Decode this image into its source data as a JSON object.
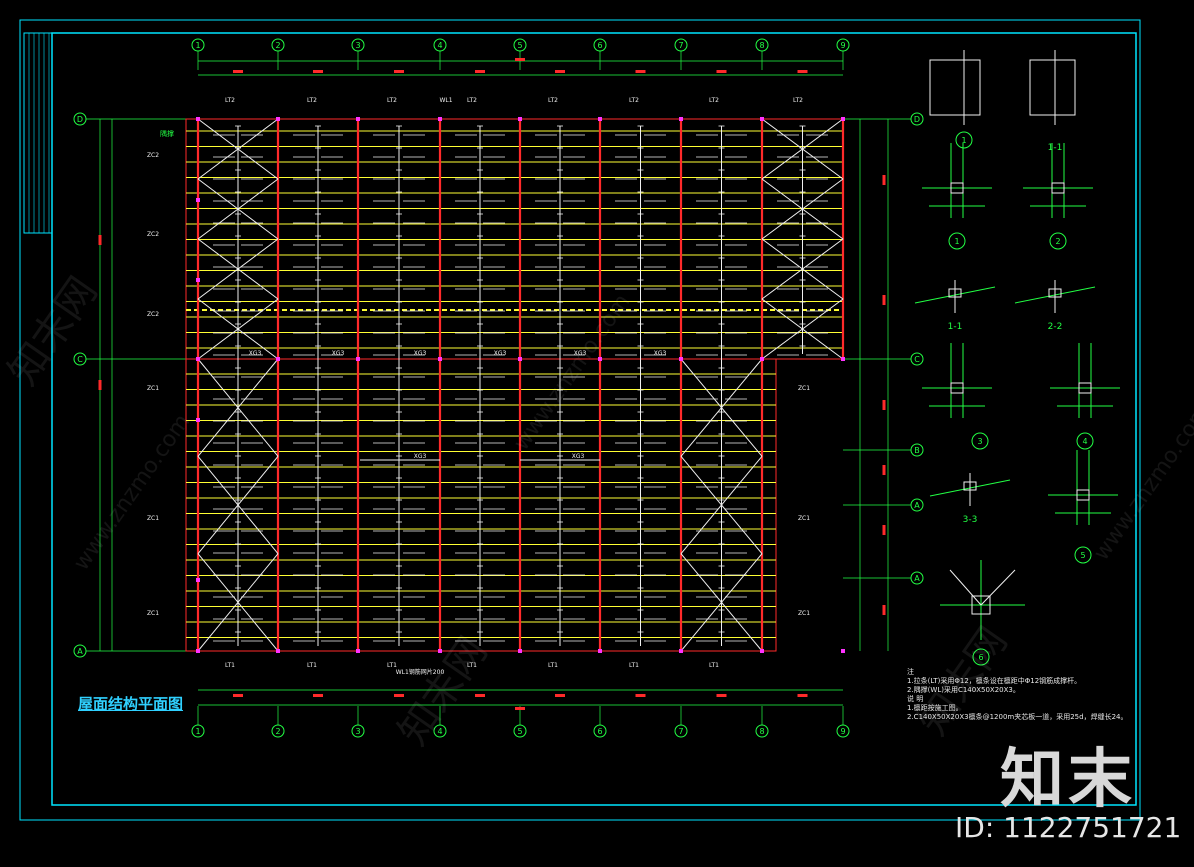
{
  "drawing": {
    "title": "屋面结构平面图",
    "axes_x": [
      "1",
      "2",
      "3",
      "4",
      "5",
      "6",
      "7",
      "8",
      "9"
    ],
    "axes_y_left": [
      "D",
      "C",
      "A"
    ],
    "axes_y_right": [
      "D",
      "C",
      "B",
      "A",
      "A"
    ],
    "top_labels": [
      "LT2",
      "LT2",
      "LT2",
      "WL1",
      "LT2",
      "LT2",
      "LT2",
      "LT2",
      "LT2"
    ],
    "bottom_labels": [
      "LT1",
      "LT1",
      "LT1",
      "LT1",
      "LT1",
      "LT1",
      "LT1"
    ],
    "bottom_note": "WL1钢筋网片200",
    "left_labels": [
      "ZC2",
      "ZC2",
      "ZC2",
      "ZC1",
      "ZC1",
      "ZC1"
    ],
    "right_labels": [
      "ZC1",
      "ZC1",
      "ZC1"
    ],
    "mid_label": "隅撑",
    "xg_labels": [
      "XG3",
      "XG3",
      "XG3",
      "XG3",
      "XG3",
      "XG3",
      "XG3",
      "XG3"
    ],
    "section_labels": [
      "1-1",
      "2-2",
      "3-3",
      "1-1"
    ],
    "detail_numbers": [
      "1",
      "2",
      "3",
      "4",
      "5",
      "6",
      "1"
    ],
    "notes": [
      "注",
      "1.拉条(LT)采用Φ12，檩条设在檩距中Φ12钢筋成撑杆。",
      "2.隅撑(WL)采用C140X50X20X3。",
      "说 明",
      "1.檩距按施工图。",
      "2.C140X50X20X3檩条@1200m夹芯板一道，采用25d，焊缝长24。"
    ]
  },
  "watermark": {
    "brand": "知末",
    "id": "ID: 1122751721",
    "url": "www.znzmo.com",
    "repeat": "知末网"
  },
  "colors": {
    "frame": "#00e5ff",
    "red": "#ff2a2a",
    "yellow": "#ffff33",
    "white": "#f0f0f0",
    "green": "#22ff44",
    "magenta": "#ff33ff",
    "background": "#000000"
  }
}
